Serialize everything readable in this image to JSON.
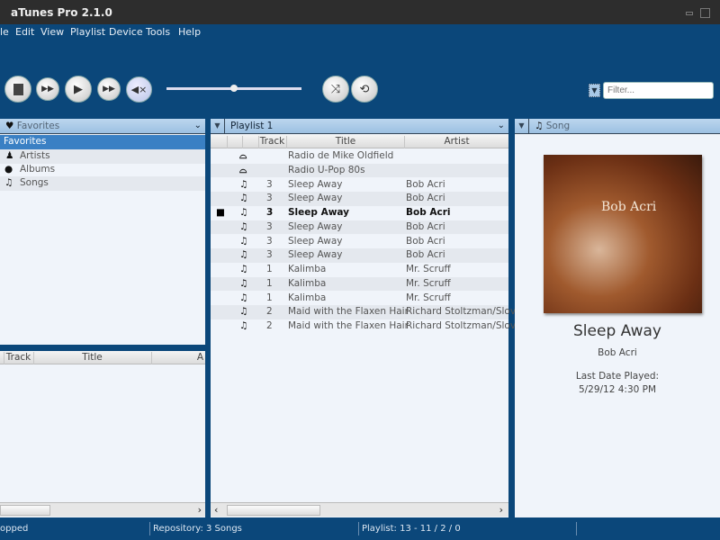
{
  "window": {
    "title": "aTunes Pro 2.1.0"
  },
  "menu": [
    "le",
    "Edit",
    "View",
    "Playlist",
    "Device",
    "Tools",
    "Help"
  ],
  "toolbar": {
    "filter_placeholder": "Filter...",
    "volume_level": 0.5
  },
  "navigator": {
    "selector": "Favorites",
    "tree_header": "Favorites",
    "items": [
      {
        "label": "Artists",
        "icon": "person-icon"
      },
      {
        "label": "Albums",
        "icon": "disc-icon"
      },
      {
        "label": "Songs",
        "icon": "music-note-icon"
      }
    ],
    "columns": [
      "Track",
      "Title",
      "A"
    ]
  },
  "playlist": {
    "selector": "Playlist 1",
    "columns": [
      "Track",
      "Title",
      "Artist"
    ],
    "rows": [
      {
        "icon": "radio-icon",
        "track": "",
        "title": "Radio de Mike Oldfield",
        "artist": ""
      },
      {
        "icon": "radio-icon",
        "track": "",
        "title": "Radio U-Pop 80s",
        "artist": ""
      },
      {
        "icon": "music-note-icon",
        "track": "3",
        "title": "Sleep Away",
        "artist": "Bob Acri"
      },
      {
        "icon": "music-note-icon",
        "track": "3",
        "title": "Sleep Away",
        "artist": "Bob Acri"
      },
      {
        "icon": "music-note-icon",
        "track": "3",
        "title": "Sleep Away",
        "artist": "Bob Acri",
        "playing": true
      },
      {
        "icon": "music-note-icon",
        "track": "3",
        "title": "Sleep Away",
        "artist": "Bob Acri"
      },
      {
        "icon": "music-note-icon",
        "track": "3",
        "title": "Sleep Away",
        "artist": "Bob Acri"
      },
      {
        "icon": "music-note-icon",
        "track": "3",
        "title": "Sleep Away",
        "artist": "Bob Acri"
      },
      {
        "icon": "music-note-icon",
        "track": "1",
        "title": "Kalimba",
        "artist": "Mr. Scruff"
      },
      {
        "icon": "music-note-icon",
        "track": "1",
        "title": "Kalimba",
        "artist": "Mr. Scruff"
      },
      {
        "icon": "music-note-icon",
        "track": "1",
        "title": "Kalimba",
        "artist": "Mr. Scruff"
      },
      {
        "icon": "music-note-icon",
        "track": "2",
        "title": "Maid with the Flaxen Hair",
        "artist": "Richard Stoltzman/Slova"
      },
      {
        "icon": "music-note-icon",
        "track": "2",
        "title": "Maid with the Flaxen Hair",
        "artist": "Richard Stoltzman/Slova"
      }
    ]
  },
  "song": {
    "header": "Song",
    "title": "Sleep Away",
    "artist": "Bob Acri",
    "last_played_label": "Last Date Played:",
    "last_played": "5/29/12 4:30 PM",
    "cover_text": "Bob Acri"
  },
  "status": {
    "state": "opped",
    "repository": "Repository: 3 Songs",
    "playlist": "Playlist: 13 - 11 / 2 / 0"
  }
}
